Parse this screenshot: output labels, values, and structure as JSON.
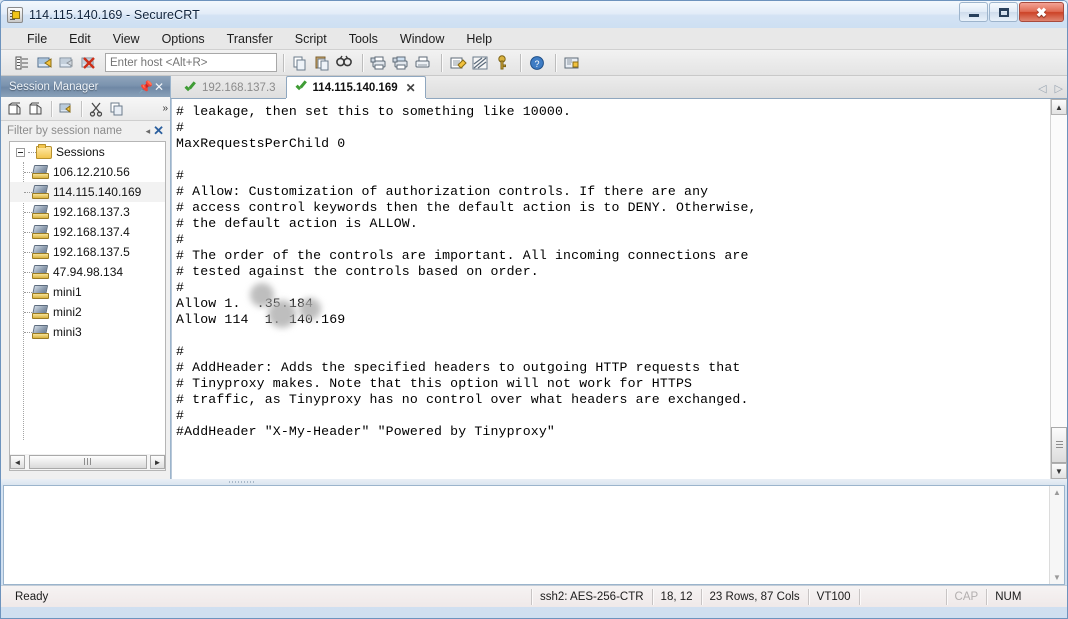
{
  "window": {
    "title": "114.115.140.169 - SecureCRT",
    "icon": "securecrt-icon",
    "minimize_label": "Minimize",
    "maximize_label": "Maximize",
    "close_label": "Close"
  },
  "menubar": {
    "items": [
      {
        "label": "File"
      },
      {
        "label": "Edit"
      },
      {
        "label": "View"
      },
      {
        "label": "Options"
      },
      {
        "label": "Transfer"
      },
      {
        "label": "Script"
      },
      {
        "label": "Tools"
      },
      {
        "label": "Window"
      },
      {
        "label": "Help"
      }
    ]
  },
  "toolbar": {
    "host_placeholder": "Enter host <Alt+R>",
    "host_value": "",
    "icons": [
      {
        "name": "session-manager-icon",
        "title": "Session Manager"
      },
      {
        "name": "connect-icon",
        "title": "Connect"
      },
      {
        "name": "connect-sftp-icon",
        "title": "Connect in Tab"
      },
      {
        "name": "disconnect-icon",
        "title": "Disconnect"
      },
      {
        "name": "copy-icon",
        "title": "Copy"
      },
      {
        "name": "paste-icon",
        "title": "Paste"
      },
      {
        "name": "find-icon",
        "title": "Find"
      },
      {
        "name": "print-icon",
        "title": "Print"
      },
      {
        "name": "print-selection-icon",
        "title": "Print Selection"
      },
      {
        "name": "print-screen-icon",
        "title": "Print Screen"
      },
      {
        "name": "log-session-icon",
        "title": "Log Session"
      },
      {
        "name": "clear-screen-icon",
        "title": "Clear Screen"
      },
      {
        "name": "key-icon",
        "title": "Key"
      },
      {
        "name": "help-icon",
        "title": "Help"
      },
      {
        "name": "properties-icon",
        "title": "Session Options"
      }
    ]
  },
  "session_manager": {
    "title": "Session Manager",
    "pin_icon": "pin-icon",
    "close_icon": "close-icon",
    "filter_placeholder": "Filter by session name",
    "filter_value": "",
    "filter_clear_icon": "clear-filter-icon",
    "toolbar_icons": [
      {
        "name": "new-session-icon",
        "title": "New Session"
      },
      {
        "name": "new-folder-icon",
        "title": "New Folder"
      },
      {
        "name": "connect-session-icon",
        "title": "Connect"
      },
      {
        "name": "cut-icon",
        "title": "Cut"
      },
      {
        "name": "copy-session-icon",
        "title": "Copy"
      },
      {
        "name": "overflow-icon",
        "title": "More"
      }
    ],
    "root": {
      "label": "Sessions",
      "icon": "folder-icon",
      "expanded": true
    },
    "sessions": [
      {
        "label": "106.12.210.56",
        "icon": "session-icon",
        "selected": false
      },
      {
        "label": "114.115.140.169",
        "icon": "session-icon",
        "selected": true
      },
      {
        "label": "192.168.137.3",
        "icon": "session-icon",
        "selected": false
      },
      {
        "label": "192.168.137.4",
        "icon": "session-icon",
        "selected": false
      },
      {
        "label": "192.168.137.5",
        "icon": "session-icon",
        "selected": false
      },
      {
        "label": "47.94.98.134",
        "icon": "session-icon",
        "selected": false
      },
      {
        "label": "mini1",
        "icon": "session-icon",
        "selected": false
      },
      {
        "label": "mini2",
        "icon": "session-icon",
        "selected": false
      },
      {
        "label": "mini3",
        "icon": "session-icon",
        "selected": false
      }
    ],
    "hscroll": {
      "left_arrow": "◄",
      "right_arrow": "►"
    }
  },
  "tabs": {
    "items": [
      {
        "label": "192.168.137.3",
        "status_icon": "connected-check-icon",
        "active": false,
        "closable": false
      },
      {
        "label": "114.115.140.169",
        "status_icon": "connected-check-icon",
        "active": true,
        "closable": true
      }
    ],
    "close_icon": "close-icon",
    "nav_prev_icon": "nav-prev-icon",
    "nav_next_icon": "nav-next-icon"
  },
  "terminal": {
    "content": "# leakage, then set this to something like 10000.\n#\nMaxRequestsPerChild 0\n\n#\n# Allow: Customization of authorization controls. If there are any\n# access control keywords then the default action is to DENY. Otherwise,\n# the default action is ALLOW.\n#\n# The order of the controls are important. All incoming connections are\n# tested against the controls based on order.\n#\nAllow 1.  .35.184\nAllow 114  1. 140.169\n\n#\n# AddHeader: Adds the specified headers to outgoing HTTP requests that\n# Tinyproxy makes. Note that this option will not work for HTTPS\n# traffic, as Tinyproxy has no control over what headers are exchanged.\n#\n#AddHeader \"X-My-Header\" \"Powered by Tinyproxy\"",
    "scroll_up_icon": "scroll-up-icon",
    "scroll_down_icon": "scroll-down-icon"
  },
  "bottom_pane": {
    "content": "",
    "scroll_up_icon": "scroll-up-icon",
    "scroll_down_icon": "scroll-down-icon"
  },
  "statusbar": {
    "ready": "Ready",
    "protocol": "ssh2: AES-256-CTR",
    "cursor": "18, 12",
    "dimensions": "23 Rows, 87 Cols",
    "emulation": "VT100",
    "spacer": "",
    "caps": "CAP",
    "num": "NUM"
  },
  "colors": {
    "accent": "#7b93ae",
    "check_green": "#3f9c35",
    "title_bg": "#d4e3f4",
    "terminal_bg": "#ffffff",
    "terminal_fg": "#000000"
  }
}
